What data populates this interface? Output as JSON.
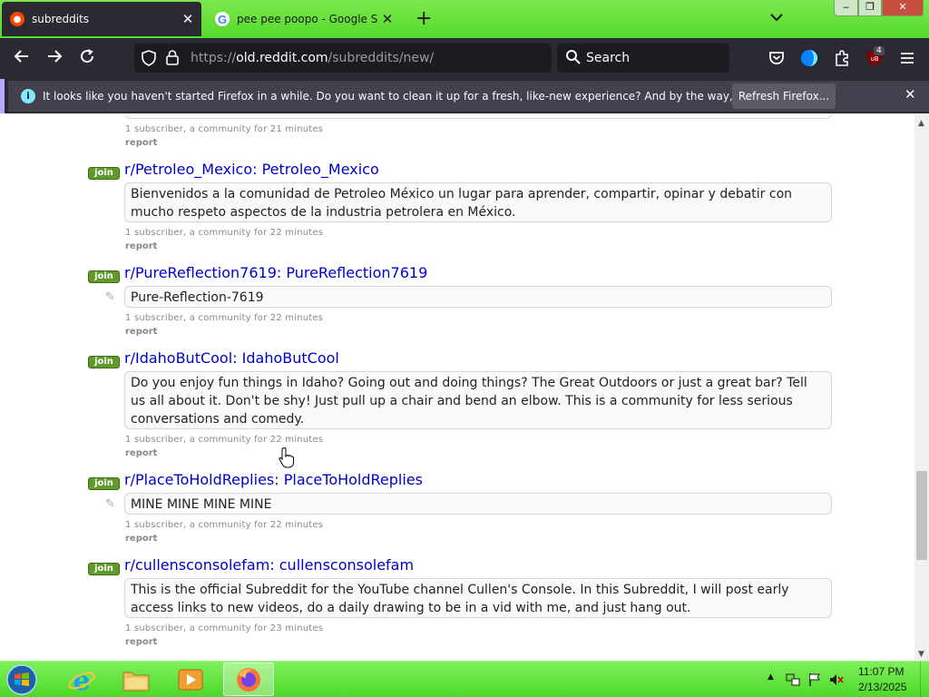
{
  "browser": {
    "tabs": [
      {
        "label": "subreddits",
        "active": true
      },
      {
        "label": "pee pee poopo - Google Search",
        "active": false
      }
    ],
    "url": {
      "scheme": "https://",
      "host": "old.reddit.com",
      "path": "/subreddits/new/"
    },
    "search_placeholder": "Search",
    "extension_badge": "4",
    "notification": {
      "message": "It looks like you haven't started Firefox in a while. Do you want to clean it up for a fresh, like-new experience? And by the way, welcome back!",
      "button": "Refresh Firefox..."
    }
  },
  "page": {
    "top_partial": {
      "meta": "1 subscriber, a community for 21 minutes",
      "report": "report"
    },
    "subreddits": [
      {
        "title": "r/Petroleo_Mexico: Petroleo_Mexico",
        "join": "join",
        "description": "Bienvenidos a la comunidad de Petroleo México un lugar para aprender, compartir, opinar y debatir con mucho respeto aspectos de la industria petrolera en México.",
        "meta": "1 subscriber, a community for 22 minutes",
        "report": "report",
        "has_pencil": false
      },
      {
        "title": "r/PureReflection7619: PureReflection7619",
        "join": "join",
        "description": "Pure-Reflection-7619",
        "meta": "1 subscriber, a community for 22 minutes",
        "report": "report",
        "has_pencil": true
      },
      {
        "title": "r/IdahoButCool: IdahoButCool",
        "join": "join",
        "description": "Do you enjoy fun things in Idaho? Going out and doing things? The Great Outdoors or just a great bar? Tell us all about it. Don't be shy! Just pull up a chair and bend an elbow. This is a community for less serious conversations and comedy.",
        "meta": "1 subscriber, a community for 22 minutes",
        "report": "report",
        "has_pencil": false
      },
      {
        "title": "r/PlaceToHoldReplies: PlaceToHoldReplies",
        "join": "join",
        "description": "MINE MINE MINE MINE",
        "meta": "1 subscriber, a community for 22 minutes",
        "report": "report",
        "has_pencil": true
      },
      {
        "title": "r/cullensconsolefam: cullensconsolefam",
        "join": "join",
        "description": "This is the official Subreddit for the YouTube channel Cullen's Console. In this Subreddit, I will post early access links to new videos, do a daily drawing to be in a vid with me, and just hang out.",
        "meta": "1 subscriber, a community for 23 minutes",
        "report": "report",
        "has_pencil": false
      }
    ]
  },
  "taskbar": {
    "clock_time": "11:07 PM",
    "clock_date": "2/13/2025"
  },
  "colors": {
    "taskbar_green": "#53d92c",
    "browser_dark": "#2b2a33",
    "link_blue": "#0000cc",
    "join_green": "#5f9a2b"
  }
}
